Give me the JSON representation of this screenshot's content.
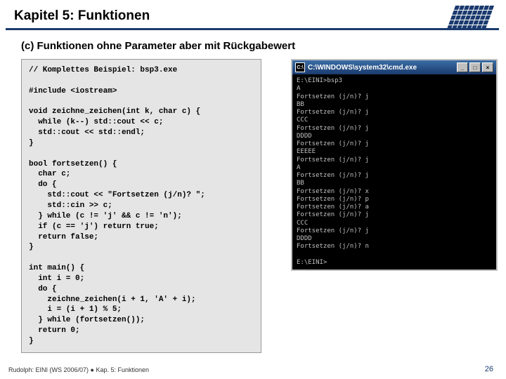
{
  "title": "Kapitel 5: Funktionen",
  "subtitle": "(c) Funktionen ohne Parameter aber mit Rückgabewert",
  "code": "// Komplettes Beispiel: bsp3.exe\n\n#include <iostream>\n\nvoid zeichne_zeichen(int k, char c) {\n  while (k--) std::cout << c;\n  std::cout << std::endl;\n}\n\nbool fortsetzen() {\n  char c;\n  do {\n    std::cout << \"Fortsetzen (j/n)? \";\n    std::cin >> c;\n  } while (c != 'j' && c != 'n');\n  if (c == 'j') return true;\n  return false;\n}\n\nint main() {\n  int i = 0;\n  do {\n    zeichne_zeichen(i + 1, 'A' + i);\n    i = (i + 1) % 5;\n  } while (fortsetzen());\n  return 0;\n}",
  "cmd": {
    "icon": "C:\\",
    "title": "C:\\WINDOWS\\system32\\cmd.exe",
    "min": "_",
    "max": "□",
    "close": "×",
    "out": "E:\\EINI>bsp3\nA\nFortsetzen (j/n)? j\nBB\nFortsetzen (j/n)? j\nCCC\nFortsetzen (j/n)? j\nDDDD\nFortsetzen (j/n)? j\nEEEEE\nFortsetzen (j/n)? j\nA\nFortsetzen (j/n)? j\nBB\nFortsetzen (j/n)? x\nFortsetzen (j/n)? p\nFortsetzen (j/n)? a\nFortsetzen (j/n)? j\nCCC\nFortsetzen (j/n)? j\nDDDD\nFortsetzen (j/n)? n\n\nE:\\EINI>"
  },
  "footer": "Rudolph: EINI (WS 2006/07)  ●  Kap. 5: Funktionen",
  "page": "26"
}
